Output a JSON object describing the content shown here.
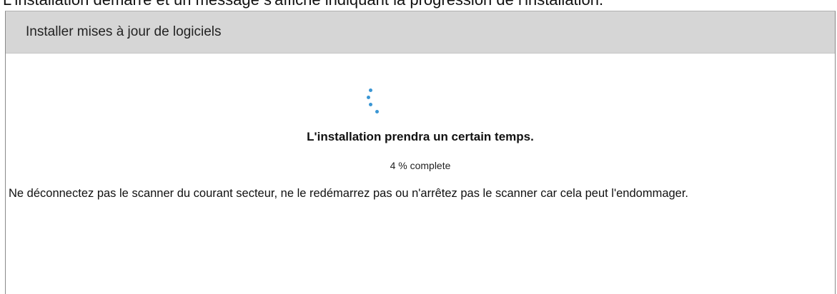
{
  "caption": "L'installation démarre et un message s'affiche indiquant la progression de l'installation.",
  "dialog": {
    "title": "Installer mises à jour de logiciels",
    "headline": "L'installation prendra un certain temps.",
    "progress": {
      "percent": 4,
      "text": "4 % complete"
    },
    "warning": "Ne déconnectez pas le scanner du courant secteur, ne le redémarrez pas ou n'arrêtez pas le scanner car cela peut l'endommager.",
    "spinner_icon": "loading-spinner-icon"
  },
  "colors": {
    "header_bg": "#d6d6d6",
    "spinner": "#3a96d4"
  }
}
